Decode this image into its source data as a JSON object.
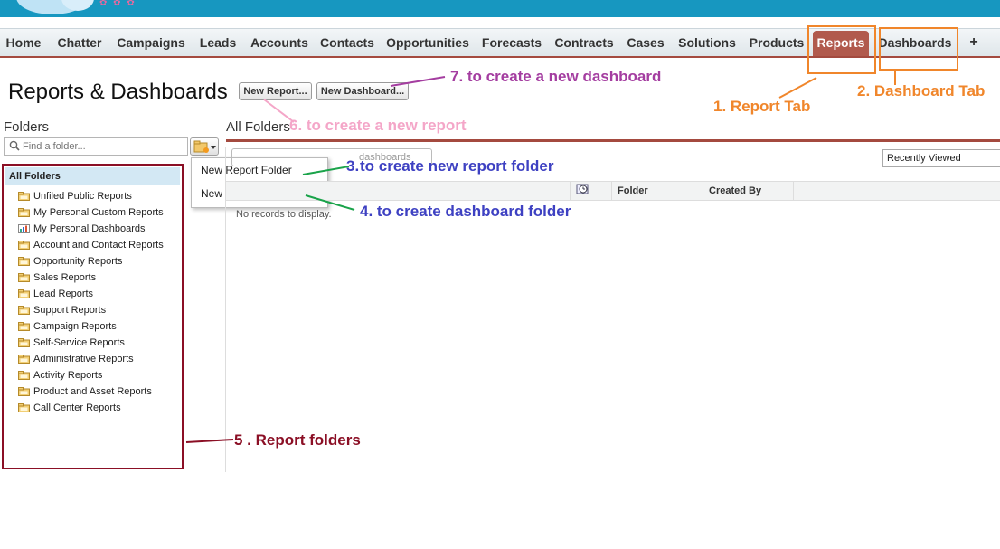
{
  "nav": {
    "tabs": [
      {
        "label": "Home",
        "active": false
      },
      {
        "label": "Chatter",
        "active": false
      },
      {
        "label": "Campaigns",
        "active": false
      },
      {
        "label": "Leads",
        "active": false
      },
      {
        "label": "Accounts",
        "active": false
      },
      {
        "label": "Contacts",
        "active": false
      },
      {
        "label": "Opportunities",
        "active": false
      },
      {
        "label": "Forecasts",
        "active": false
      },
      {
        "label": "Contracts",
        "active": false
      },
      {
        "label": "Cases",
        "active": false
      },
      {
        "label": "Solutions",
        "active": false
      },
      {
        "label": "Products",
        "active": false
      },
      {
        "label": "Reports",
        "active": true
      },
      {
        "label": "Dashboards",
        "active": false
      }
    ],
    "more_icon": "+"
  },
  "header": {
    "title": "Reports & Dashboards",
    "new_report_label": "New Report...",
    "new_dashboard_label": "New Dashboard..."
  },
  "sidebar": {
    "folders_label": "Folders",
    "find_placeholder": "Find a folder...",
    "all_folders": "All Folders",
    "items": [
      {
        "label": "Unfiled Public Reports",
        "icon": "report-folder-icon"
      },
      {
        "label": "My Personal Custom Reports",
        "icon": "report-folder-icon"
      },
      {
        "label": "My Personal Dashboards",
        "icon": "dashboard-icon"
      },
      {
        "label": "Account and Contact Reports",
        "icon": "report-folder-icon"
      },
      {
        "label": "Opportunity Reports",
        "icon": "report-folder-icon"
      },
      {
        "label": "Sales Reports",
        "icon": "report-folder-icon"
      },
      {
        "label": "Lead Reports",
        "icon": "report-folder-icon"
      },
      {
        "label": "Support Reports",
        "icon": "report-folder-icon"
      },
      {
        "label": "Campaign Reports",
        "icon": "report-folder-icon"
      },
      {
        "label": "Self-Service Reports",
        "icon": "report-folder-icon"
      },
      {
        "label": "Administrative Reports",
        "icon": "report-folder-icon"
      },
      {
        "label": "Activity Reports",
        "icon": "report-folder-icon"
      },
      {
        "label": "Product and Asset Reports",
        "icon": "report-folder-icon"
      },
      {
        "label": "Call Center Reports",
        "icon": "report-folder-icon"
      }
    ]
  },
  "folder_menu": {
    "new_report_folder": "New Report Folder",
    "new_dashboard_folder": "New Dashboard Folder"
  },
  "main": {
    "title": "All Folders",
    "search_partial": "dashboards",
    "view_select": "Recently Viewed",
    "columns": [
      "Folder",
      "Created By"
    ],
    "empty_text": "No records to display."
  },
  "annotations": {
    "a1": "1.  Report Tab",
    "a2": "2.  Dashboard Tab",
    "a3": "3.",
    "a3_text": "to create new report folder",
    "a4": "4. to create dashboard folder",
    "a5": "5 . Report folders",
    "a6": "6. to create a new report",
    "a7": "7. to create a new dashboard"
  },
  "colors": {
    "banner": "#1797c0",
    "active_tab": "#b15a4d",
    "highlight_box": "#f0862b",
    "annotation_orange": "#f0862b",
    "annotation_blue": "#3e41c2",
    "annotation_purple": "#a43da0",
    "annotation_pink": "#f4a6c8",
    "annotation_maroon": "#8b0f25",
    "arrow_green": "#1aa34a"
  }
}
